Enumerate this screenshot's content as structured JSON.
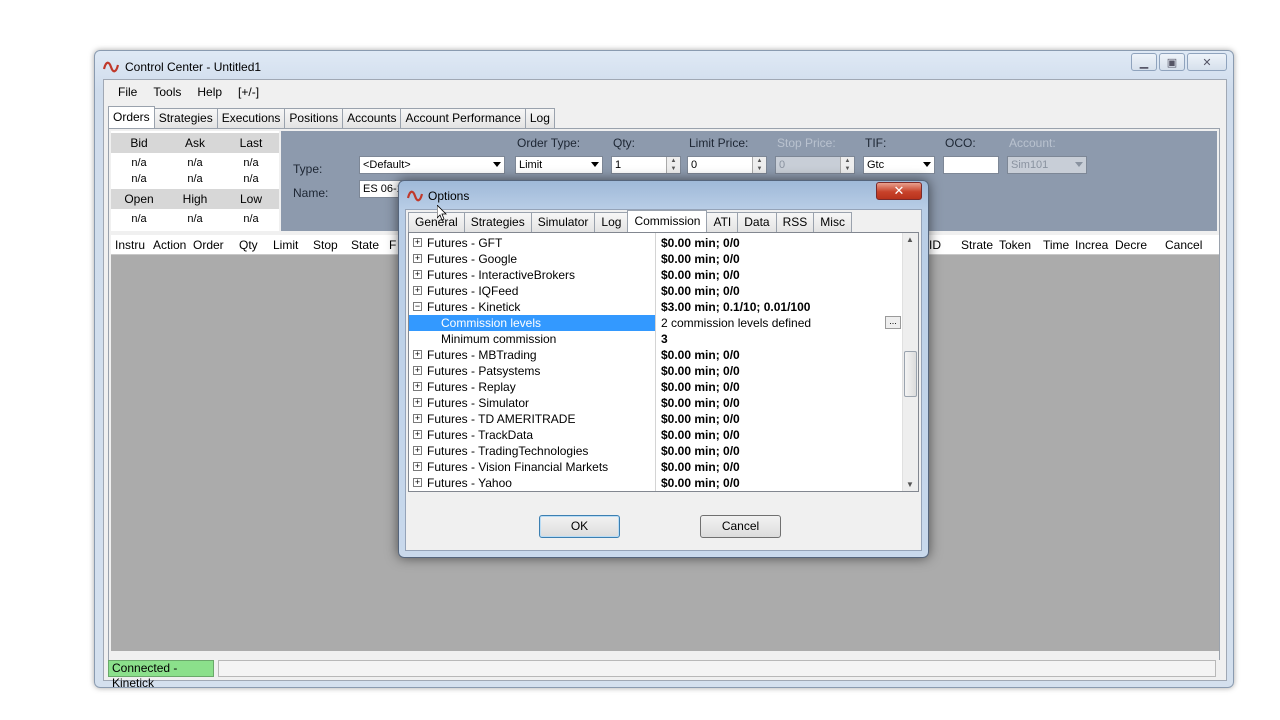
{
  "main_window": {
    "title": "Control Center - Untitled1",
    "menu": [
      "File",
      "Tools",
      "Help",
      "[+/-]"
    ],
    "tabs": [
      "Orders",
      "Strategies",
      "Executions",
      "Positions",
      "Accounts",
      "Account Performance",
      "Log"
    ],
    "active_tab": "Orders"
  },
  "quote": {
    "headers1": [
      "Bid",
      "Ask",
      "Last"
    ],
    "row1": [
      "n/a",
      "n/a",
      "n/a"
    ],
    "row2": [
      "n/a",
      "n/a",
      "n/a"
    ],
    "headers2": [
      "Open",
      "High",
      "Low"
    ],
    "row3": [
      "n/a",
      "n/a",
      "n/a"
    ]
  },
  "order_entry": {
    "type_label": "Type:",
    "type_value": "<Default>",
    "name_label": "Name:",
    "name_value": "ES 06-1",
    "order_type_label": "Order Type:",
    "order_type_value": "Limit",
    "qty_label": "Qty:",
    "qty_value": "1",
    "limit_price_label": "Limit Price:",
    "limit_price_value": "0",
    "stop_price_label": "Stop Price:",
    "stop_price_value": "0",
    "tif_label": "TIF:",
    "tif_value": "Gtc",
    "oco_label": "OCO:",
    "oco_value": "",
    "account_label": "Account:",
    "account_value": "Sim101"
  },
  "orders_grid": {
    "left_columns": [
      "Instru",
      "Action",
      "Order",
      "Qty",
      "Limit",
      "Stop",
      "State",
      "F"
    ],
    "right_columns": [
      "ID",
      "Strate",
      "Token",
      "Time",
      "Increa",
      "Decre",
      "Cancel"
    ]
  },
  "status_bar": {
    "connection": "Connected - Kinetick"
  },
  "options_dialog": {
    "title": "Options",
    "close_label": "✕",
    "tabs": [
      "General",
      "Strategies",
      "Simulator",
      "Log",
      "Commission",
      "ATI",
      "Data",
      "RSS",
      "Misc"
    ],
    "active_tab": "Commission",
    "rows": [
      {
        "name": "Futures - GFT",
        "value": "$0.00 min;  0/0",
        "expander": "+",
        "sub": false,
        "bold": true
      },
      {
        "name": "Futures - Google",
        "value": "$0.00 min;  0/0",
        "expander": "+",
        "sub": false,
        "bold": true
      },
      {
        "name": "Futures - InteractiveBrokers",
        "value": "$0.00 min;  0/0",
        "expander": "+",
        "sub": false,
        "bold": true
      },
      {
        "name": "Futures - IQFeed",
        "value": "$0.00 min;  0/0",
        "expander": "+",
        "sub": false,
        "bold": true
      },
      {
        "name": "Futures - Kinetick",
        "value": "$3.00 min;  0.1/10;  0.01/100",
        "expander": "−",
        "sub": false,
        "bold": true
      },
      {
        "name": "Commission levels",
        "value": "2 commission levels defined",
        "expander": "",
        "sub": true,
        "bold": false,
        "selected": true,
        "ellipsis": true
      },
      {
        "name": "Minimum commission",
        "value": "3",
        "expander": "",
        "sub": true,
        "bold": true
      },
      {
        "name": "Futures - MBTrading",
        "value": "$0.00 min;  0/0",
        "expander": "+",
        "sub": false,
        "bold": true
      },
      {
        "name": "Futures - Patsystems",
        "value": "$0.00 min;  0/0",
        "expander": "+",
        "sub": false,
        "bold": true
      },
      {
        "name": "Futures - Replay",
        "value": "$0.00 min;  0/0",
        "expander": "+",
        "sub": false,
        "bold": true
      },
      {
        "name": "Futures - Simulator",
        "value": "$0.00 min;  0/0",
        "expander": "+",
        "sub": false,
        "bold": true
      },
      {
        "name": "Futures - TD AMERITRADE",
        "value": "$0.00 min;  0/0",
        "expander": "+",
        "sub": false,
        "bold": true
      },
      {
        "name": "Futures - TrackData",
        "value": "$0.00 min;  0/0",
        "expander": "+",
        "sub": false,
        "bold": true
      },
      {
        "name": "Futures - TradingTechnologies",
        "value": "$0.00 min;  0/0",
        "expander": "+",
        "sub": false,
        "bold": true
      },
      {
        "name": "Futures - Vision Financial Markets",
        "value": "$0.00 min;  0/0",
        "expander": "+",
        "sub": false,
        "bold": true
      },
      {
        "name": "Futures - Yahoo",
        "value": "$0.00 min;  0/0",
        "expander": "+",
        "sub": false,
        "bold": true
      }
    ],
    "ok_label": "OK",
    "cancel_label": "Cancel"
  },
  "colors": {
    "order_entry_bg": "#8d9aad",
    "selection": "#3399ff",
    "status_connected": "#8be08b"
  },
  "icons": {
    "app": "ninja-wave-icon",
    "minimize": "minimize-icon",
    "maximize": "maximize-icon",
    "close": "close-icon"
  }
}
